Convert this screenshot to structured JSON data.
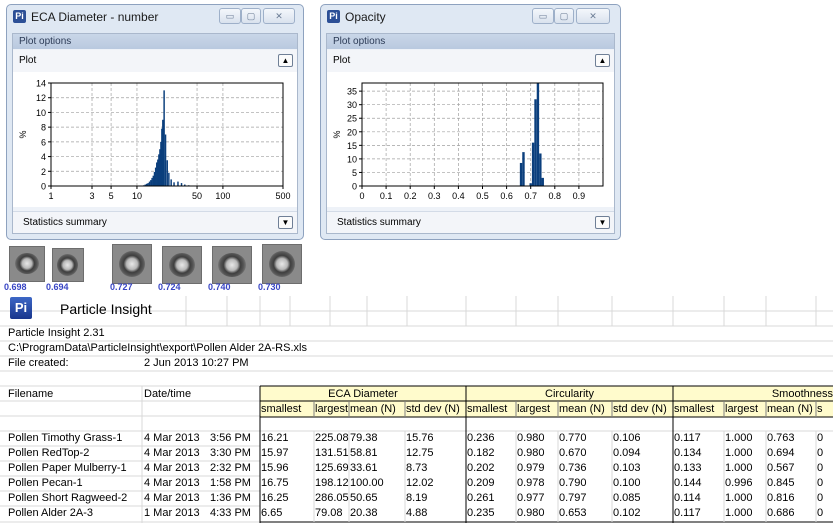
{
  "windows": {
    "ecd": {
      "title": "ECA Diameter - number",
      "plot_options_label": "Plot options",
      "plot_label": "Plot",
      "stats_label": "Statistics summary",
      "minimize_glyph": "▭",
      "maximize_glyph": "▢",
      "close_glyph": "✕"
    },
    "opacity": {
      "title": "Opacity",
      "plot_options_label": "Plot options",
      "plot_label": "Plot",
      "stats_label": "Statistics summary",
      "minimize_glyph": "▭",
      "maximize_glyph": "▢",
      "close_glyph": "✕"
    },
    "app_icon_letter": "Pi",
    "collapse_glyph_up": "▲",
    "collapse_glyph_down": "▼"
  },
  "chart_data": [
    {
      "type": "bar",
      "title": "",
      "xlabel": "",
      "ylabel": "%",
      "x_scale": "log",
      "xlim": [
        1,
        500
      ],
      "ylim": [
        0,
        14
      ],
      "x_ticks": [
        1,
        3,
        5,
        10,
        50,
        100,
        500
      ],
      "x_tick_labels": [
        "1",
        "3",
        "5",
        "10",
        "50",
        "100",
        "500"
      ],
      "y_ticks": [
        0,
        2,
        4,
        6,
        8,
        10,
        12,
        14
      ],
      "y_tick_labels": [
        "0",
        "2",
        "4",
        "6",
        "8",
        "10",
        "12",
        "14"
      ],
      "grid": true,
      "bar_color": "#0b3f7d",
      "x": [
        12,
        12.5,
        13,
        13.5,
        14,
        14.5,
        15,
        15.5,
        16,
        16.5,
        17,
        17.5,
        18,
        18.5,
        19,
        19.5,
        20,
        20.7,
        21.5,
        22.5,
        23.5,
        25,
        27,
        30,
        33,
        36,
        40
      ],
      "values": [
        0.1,
        0.2,
        0.3,
        0.4,
        0.6,
        0.8,
        1.1,
        1.4,
        1.9,
        2.5,
        3.2,
        3.6,
        4.3,
        5.0,
        6.0,
        7.8,
        9.0,
        13.0,
        7.0,
        3.5,
        1.8,
        0.9,
        0.5,
        0.6,
        0.4,
        0.2,
        0.1
      ]
    },
    {
      "type": "bar",
      "title": "",
      "xlabel": "",
      "ylabel": "%",
      "xlim": [
        0,
        1.0
      ],
      "ylim": [
        0,
        38
      ],
      "x_ticks": [
        0,
        0.1,
        0.2,
        0.3,
        0.4,
        0.5,
        0.6,
        0.7,
        0.8,
        0.9
      ],
      "x_tick_labels": [
        "0",
        "0.1",
        "0.2",
        "0.3",
        "0.4",
        "0.5",
        "0.6",
        "0.7",
        "0.8",
        "0.9"
      ],
      "y_ticks": [
        0,
        5,
        10,
        15,
        20,
        25,
        30,
        35
      ],
      "y_tick_labels": [
        "0",
        "5",
        "10",
        "15",
        "20",
        "25",
        "30",
        "35"
      ],
      "grid": true,
      "bar_color": "#0b3f7d",
      "bar_width": 0.01,
      "x": [
        0.66,
        0.67,
        0.7,
        0.71,
        0.72,
        0.73,
        0.74,
        0.75
      ],
      "values": [
        8.5,
        12.5,
        1.0,
        16.0,
        32.0,
        38.0,
        12.0,
        3.0
      ]
    }
  ],
  "thumbnails": [
    "0.698",
    "0.694",
    "0.727",
    "0.724",
    "0.740",
    "0.730"
  ],
  "logo": {
    "icon_letter": "Pi",
    "text": "Particle Insight"
  },
  "sheet": {
    "version": "Particle Insight 2.31",
    "path": "C:\\ProgramData\\ParticleInsight\\export\\Pollen Alder 2A-RS.xls",
    "created_label": "File created:",
    "created_value": "2 Jun 2013  10:27 PM",
    "col_filename": "Filename",
    "col_datetime": "Date/time",
    "groups": [
      "ECA Diameter",
      "Circularity",
      "Smoothness"
    ],
    "subheaders": [
      "smallest",
      "largest",
      "mean (N)",
      "std dev (N)",
      "smallest",
      "largest",
      "mean (N)",
      "std dev (N)",
      "smallest",
      "largest",
      "mean (N)",
      "s"
    ],
    "rows": [
      {
        "name": "Pollen Timothy Grass-1",
        "date": "4 Mar 2013",
        "time": "3:56 PM",
        "v": [
          "16.21",
          "225.08",
          "79.38",
          "15.76",
          "0.236",
          "0.980",
          "0.770",
          "0.106",
          "0.117",
          "1.000",
          "0.763",
          "0"
        ]
      },
      {
        "name": "Pollen RedTop-2",
        "date": "4 Mar 2013",
        "time": "3:30 PM",
        "v": [
          "15.97",
          "131.51",
          "58.81",
          "12.75",
          "0.182",
          "0.980",
          "0.670",
          "0.094",
          "0.134",
          "1.000",
          "0.694",
          "0"
        ]
      },
      {
        "name": "Pollen Paper Mulberry-1",
        "date": "4 Mar 2013",
        "time": "2:32 PM",
        "v": [
          "15.96",
          "125.69",
          "33.61",
          "8.73",
          "0.202",
          "0.979",
          "0.736",
          "0.103",
          "0.133",
          "1.000",
          "0.567",
          "0"
        ]
      },
      {
        "name": "Pollen Pecan-1",
        "date": "4 Mar 2013",
        "time": "1:58 PM",
        "v": [
          "16.75",
          "198.12",
          "100.00",
          "12.02",
          "0.209",
          "0.978",
          "0.790",
          "0.100",
          "0.144",
          "0.996",
          "0.845",
          "0"
        ]
      },
      {
        "name": "Pollen Short Ragweed-2",
        "date": "4 Mar 2013",
        "time": "1:36 PM",
        "v": [
          "16.25",
          "286.05",
          "50.65",
          "8.19",
          "0.261",
          "0.977",
          "0.797",
          "0.085",
          "0.114",
          "1.000",
          "0.816",
          "0"
        ]
      },
      {
        "name": "Pollen Alder 2A-3",
        "date": "1 Mar 2013",
        "time": "4:33 PM",
        "v": [
          "6.65",
          "79.08",
          "20.38",
          "4.88",
          "0.235",
          "0.980",
          "0.653",
          "0.102",
          "0.117",
          "1.000",
          "0.686",
          "0"
        ]
      }
    ]
  }
}
